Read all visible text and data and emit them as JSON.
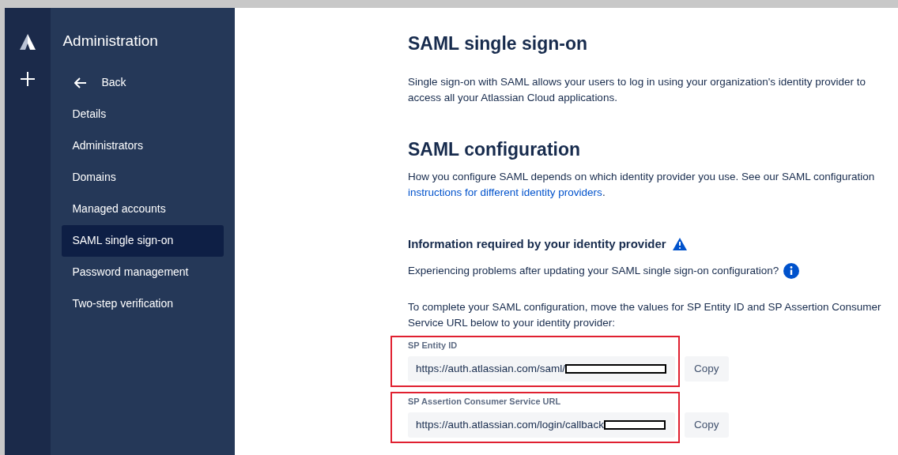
{
  "sidebar": {
    "title": "Administration",
    "back": "Back",
    "items": [
      {
        "label": "Details",
        "selected": false
      },
      {
        "label": "Administrators",
        "selected": false
      },
      {
        "label": "Domains",
        "selected": false
      },
      {
        "label": "Managed accounts",
        "selected": false
      },
      {
        "label": "SAML single sign-on",
        "selected": true
      },
      {
        "label": "Password management",
        "selected": false
      },
      {
        "label": "Two-step verification",
        "selected": false
      }
    ]
  },
  "main": {
    "title": "SAML single sign-on",
    "intro": "Single sign-on with SAML allows your users to log in using your organization's identity provider to access all your Atlassian Cloud applications.",
    "config_title": "SAML configuration",
    "config_text": "How you configure SAML depends on which identity provider you use. See our SAML configuration",
    "config_link": "instructions for different identity providers",
    "config_end": ".",
    "info_title": "Information required by your identity provider",
    "problems": "Experiencing problems after updating your SAML single sign-on configuration?",
    "instructions": "To complete your SAML configuration, move the values for SP Entity ID and SP Assertion Consumer Service URL below to your identity provider:",
    "fields": [
      {
        "label": "SP Entity ID",
        "value": "https://auth.atlassian.com/saml/",
        "button": "Copy"
      },
      {
        "label": "SP Assertion Consumer Service URL",
        "value": "https://auth.atlassian.com/login/callback",
        "button": "Copy"
      }
    ]
  }
}
